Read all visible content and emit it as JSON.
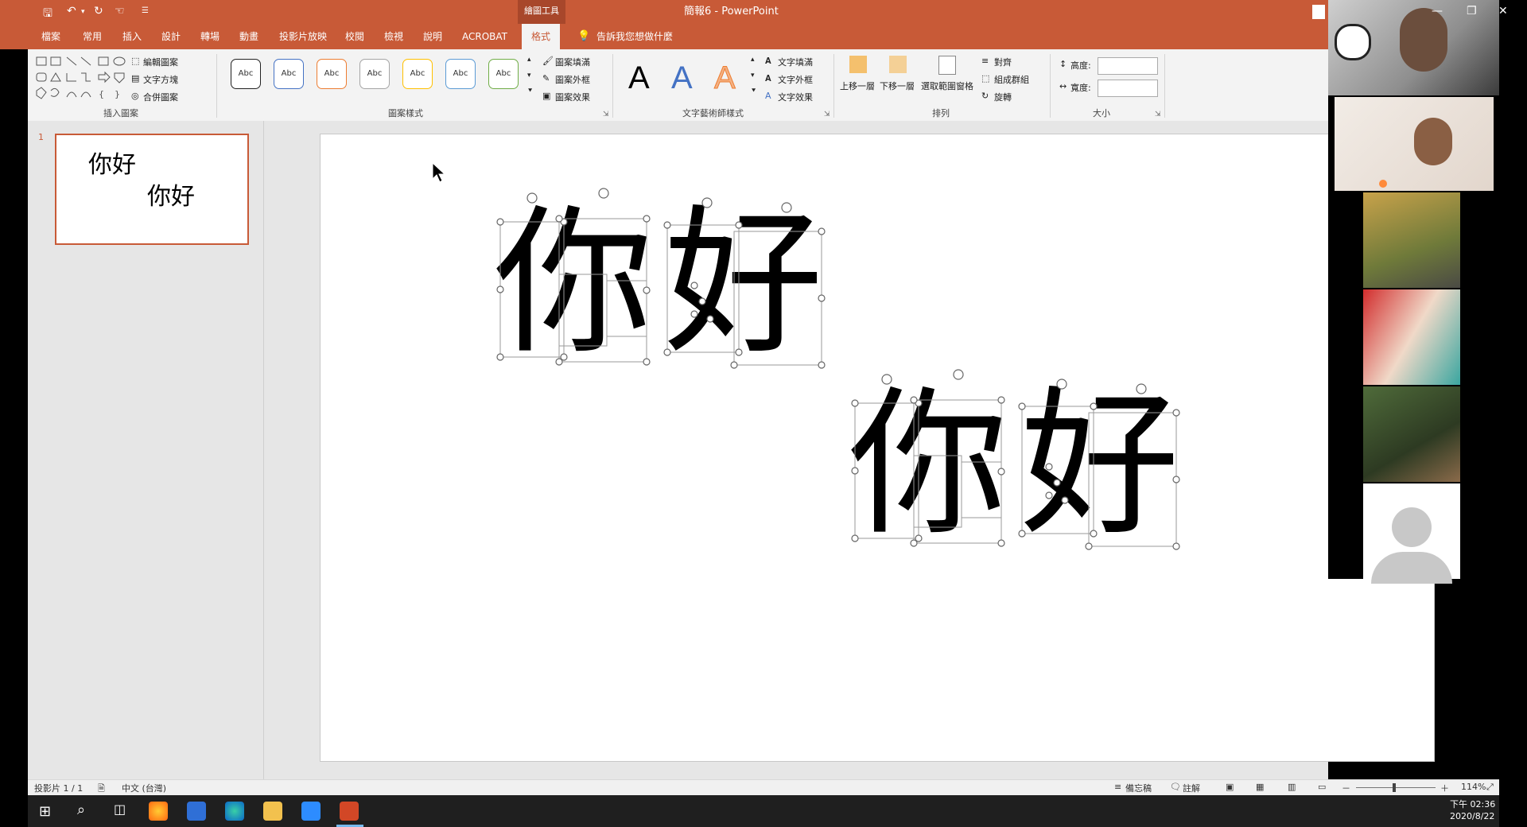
{
  "app": {
    "context_tab_group": "繪圖工具",
    "document_title": "簡報6 - PowerPoint"
  },
  "quick_access": {
    "save_icon": "save-icon",
    "undo_icon": "undo-icon",
    "redo_icon": "redo-icon",
    "touch_icon": "touch-mode-icon",
    "customize_icon": "customize-arrow-icon"
  },
  "tabs": [
    {
      "label": "檔案"
    },
    {
      "label": "常用"
    },
    {
      "label": "插入"
    },
    {
      "label": "設計"
    },
    {
      "label": "轉場"
    },
    {
      "label": "動畫"
    },
    {
      "label": "投影片放映"
    },
    {
      "label": "校閱"
    },
    {
      "label": "檢視"
    },
    {
      "label": "說明"
    },
    {
      "label": "ACROBAT"
    },
    {
      "label": "格式"
    }
  ],
  "tell_me": "告訴我您想做什麼",
  "ribbon": {
    "insert_shapes": {
      "label": "插入圖案",
      "edit_shape": "編輯圖案",
      "text_box": "文字方塊",
      "merge_shapes": "合併圖案"
    },
    "shape_styles": {
      "label": "圖案樣式",
      "swatch_text": "Abc",
      "fill": "圖案填滿",
      "outline": "圖案外框",
      "effects": "圖案效果"
    },
    "wordart": {
      "label": "文字藝術師樣式",
      "glyph": "A",
      "text_fill": "文字填滿",
      "text_outline": "文字外框",
      "text_effects": "文字效果"
    },
    "arrange": {
      "label": "排列",
      "bring_forward": "上移一層",
      "send_backward": "下移一層",
      "selection_pane": "選取範圍窗格",
      "align": "對齊",
      "group": "組成群組",
      "rotate": "旋轉"
    },
    "size": {
      "label": "大小",
      "height": "高度:",
      "width": "寬度:"
    }
  },
  "slides": {
    "number": "1",
    "line1": "你好",
    "line2": "你好"
  },
  "slide_text": {
    "char1": "你",
    "char2": "好"
  },
  "status": {
    "slide_count": "投影片 1 / 1",
    "language": "中文 (台灣)",
    "notes": "備忘稿",
    "comments": "註解",
    "zoom": "114%",
    "zoom_minus": "－",
    "zoom_plus": "＋"
  },
  "taskbar": {
    "time": "下午 02:36",
    "date": "2020/8/22"
  },
  "colors": {
    "accent": "#c85a37",
    "ribbon": "#f3f3f3"
  }
}
